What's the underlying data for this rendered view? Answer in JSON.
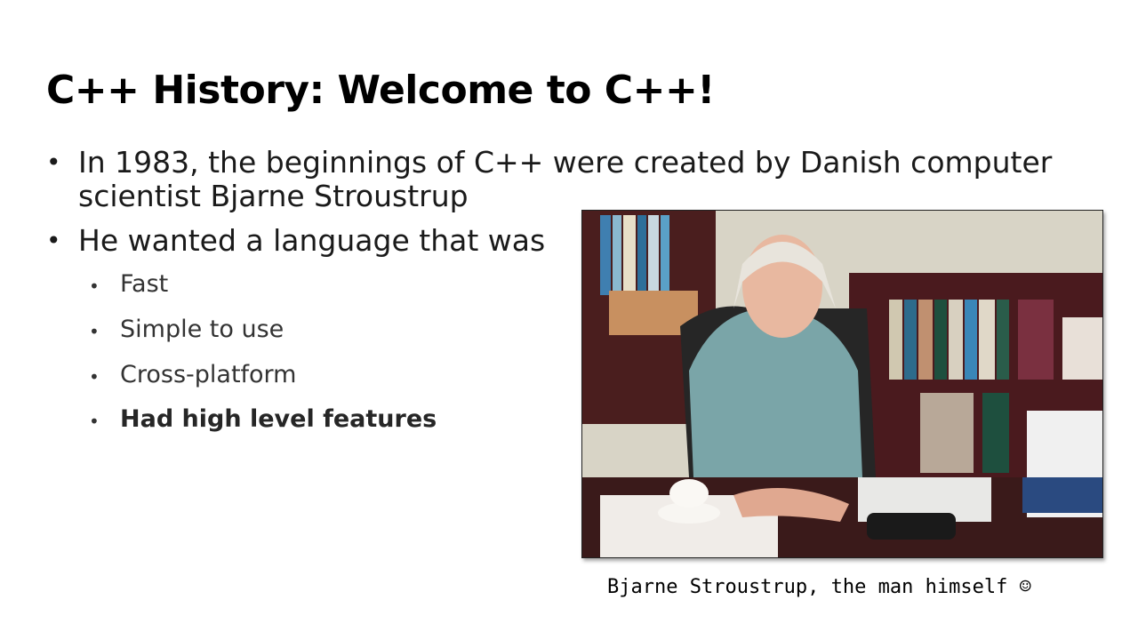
{
  "slide": {
    "title": "C++ History: Welcome to C++!",
    "bullets": [
      {
        "lines": [
          "In 1983, the beginnings of C++ were created by Danish computer",
          "scientist Bjarne Stroustrup"
        ]
      },
      {
        "lines": [
          "He wanted a language that was"
        ]
      }
    ],
    "sub_bullets": [
      "Fast",
      "Simple to use",
      "Cross-platform",
      "Had high level features"
    ],
    "bullet_char": "•",
    "image_alt": "Photo of Bjarne Stroustrup seated at his desk in front of bookshelves",
    "caption": "Bjarne Stroustrup, the man himself ☺"
  }
}
